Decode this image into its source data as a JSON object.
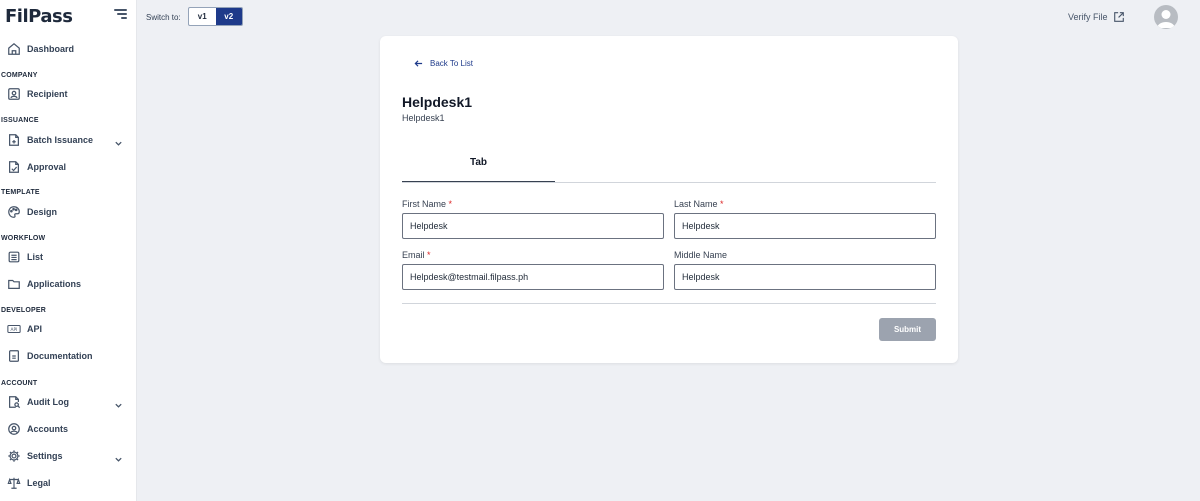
{
  "brand": {
    "logo_text": "FilPass"
  },
  "topbar": {
    "switch_label": "Switch to:",
    "switch_options": [
      "v1",
      "v2"
    ],
    "active_version": "v2",
    "verify_label": "Verify File"
  },
  "sidebar": {
    "items": [
      {
        "label": "Dashboard",
        "icon": "home-icon"
      },
      {
        "section": "COMPANY"
      },
      {
        "label": "Recipient",
        "icon": "user-card-icon"
      },
      {
        "section": "ISSUANCE"
      },
      {
        "label": "Batch Issuance",
        "icon": "document-plus-icon",
        "expandable": true
      },
      {
        "label": "Approval",
        "icon": "document-check-icon"
      },
      {
        "section": "TEMPLATE"
      },
      {
        "label": "Design",
        "icon": "palette-icon"
      },
      {
        "section": "WORKFLOW"
      },
      {
        "label": "List",
        "icon": "list-icon"
      },
      {
        "label": "Applications",
        "icon": "folder-icon"
      },
      {
        "section": "DEVELOPER"
      },
      {
        "label": "API",
        "icon": "api-icon"
      },
      {
        "label": "Documentation",
        "icon": "book-icon"
      },
      {
        "section": "ACCOUNT"
      },
      {
        "label": "Audit Log",
        "icon": "document-search-icon",
        "expandable": true
      },
      {
        "label": "Accounts",
        "icon": "user-circle-icon"
      },
      {
        "label": "Settings",
        "icon": "gear-icon",
        "expandable": true
      },
      {
        "label": "Legal",
        "icon": "scale-icon"
      }
    ]
  },
  "page": {
    "back_label": "Back To List",
    "title": "Helpdesk1",
    "subtitle": "Helpdesk1",
    "tab_label": "Tab",
    "form": {
      "first_name": {
        "label": "First Name",
        "required": "*",
        "value": "Helpdesk"
      },
      "last_name": {
        "label": "Last Name",
        "required": "*",
        "value": "Helpdesk"
      },
      "email": {
        "label": "Email",
        "required": "*",
        "value": "Helpdesk@testmail.filpass.ph"
      },
      "middle_name": {
        "label": "Middle Name",
        "value": "Helpdesk"
      }
    },
    "submit_label": "Submit"
  },
  "colors": {
    "accent": "#1e3a8a",
    "background": "#eef0f4",
    "required": "#dc2626",
    "submit_disabled": "#9ca3af"
  }
}
